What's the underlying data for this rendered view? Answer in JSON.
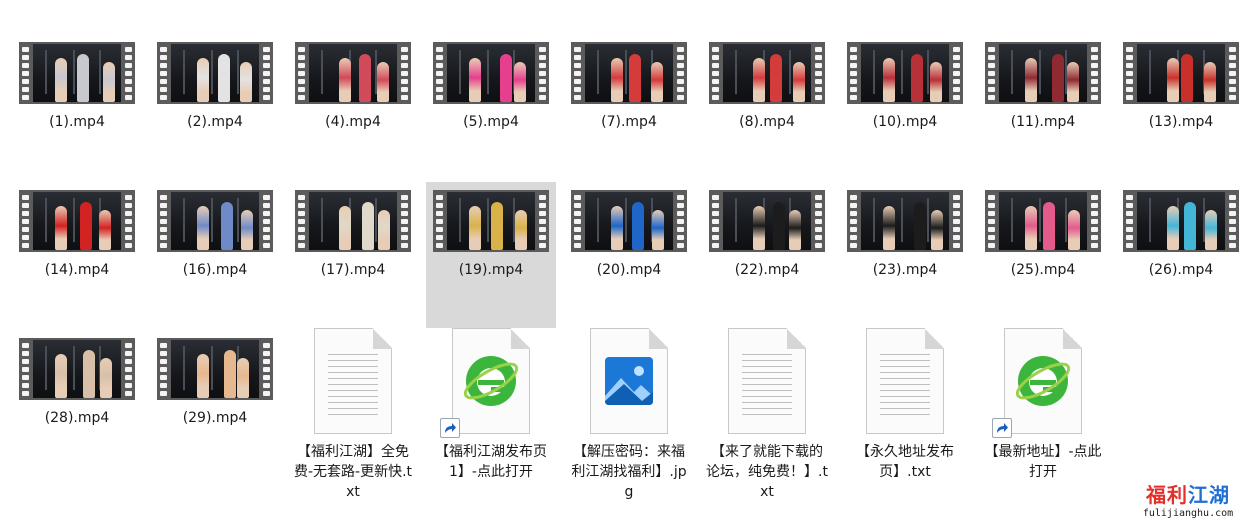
{
  "files": [
    {
      "kind": "video",
      "label": "(1).mp4",
      "tone": "#c8c8cf"
    },
    {
      "kind": "video",
      "label": "(2).mp4",
      "tone": "#e3e3e3"
    },
    {
      "kind": "video",
      "label": "(4).mp4",
      "tone": "#d14a5a"
    },
    {
      "kind": "video",
      "label": "(5).mp4",
      "tone": "#e63f8e"
    },
    {
      "kind": "video",
      "label": "(7).mp4",
      "tone": "#d43b3b"
    },
    {
      "kind": "video",
      "label": "(8).mp4",
      "tone": "#d43b3b"
    },
    {
      "kind": "video",
      "label": "(10).mp4",
      "tone": "#b83038"
    },
    {
      "kind": "video",
      "label": "(11).mp4",
      "tone": "#8f2a33"
    },
    {
      "kind": "video",
      "label": "(13).mp4",
      "tone": "#c8312b"
    },
    {
      "kind": "video",
      "label": "(14).mp4",
      "tone": "#d32222"
    },
    {
      "kind": "video",
      "label": "(16).mp4",
      "tone": "#6e8bc7"
    },
    {
      "kind": "video",
      "label": "(17).mp4",
      "tone": "#e0d8c8"
    },
    {
      "kind": "video",
      "label": "(19).mp4",
      "tone": "#d9b24a",
      "selected": true
    },
    {
      "kind": "video",
      "label": "(20).mp4",
      "tone": "#1e66c8"
    },
    {
      "kind": "video",
      "label": "(22).mp4",
      "tone": "#1c1c1c"
    },
    {
      "kind": "video",
      "label": "(23).mp4",
      "tone": "#1c1c1c"
    },
    {
      "kind": "video",
      "label": "(25).mp4",
      "tone": "#e45a8b"
    },
    {
      "kind": "video",
      "label": "(26).mp4",
      "tone": "#43b6d8"
    },
    {
      "kind": "video",
      "label": "(28).mp4",
      "tone": "#d8c0a8"
    },
    {
      "kind": "video",
      "label": "(29).mp4",
      "tone": "#e6b890"
    },
    {
      "kind": "txt",
      "label": "【福利江湖】全免费-无套路-更新快.txt"
    },
    {
      "kind": "url",
      "label": "【福利江湖发布页1】-点此打开"
    },
    {
      "kind": "jpg",
      "label": "【解压密码：来福利江湖找福利】.jpg"
    },
    {
      "kind": "txt",
      "label": "【来了就能下载的论坛，纯免费！】.txt"
    },
    {
      "kind": "txt",
      "label": "【永久地址发布页】.txt"
    },
    {
      "kind": "url",
      "label": "【最新地址】-点此打开"
    }
  ],
  "watermark": {
    "title_part1": "福利",
    "title_part2": "江湖",
    "url": "fulijianghu.com",
    "colors": {
      "red": "#e2302d",
      "blue": "#1f6fd6"
    }
  }
}
